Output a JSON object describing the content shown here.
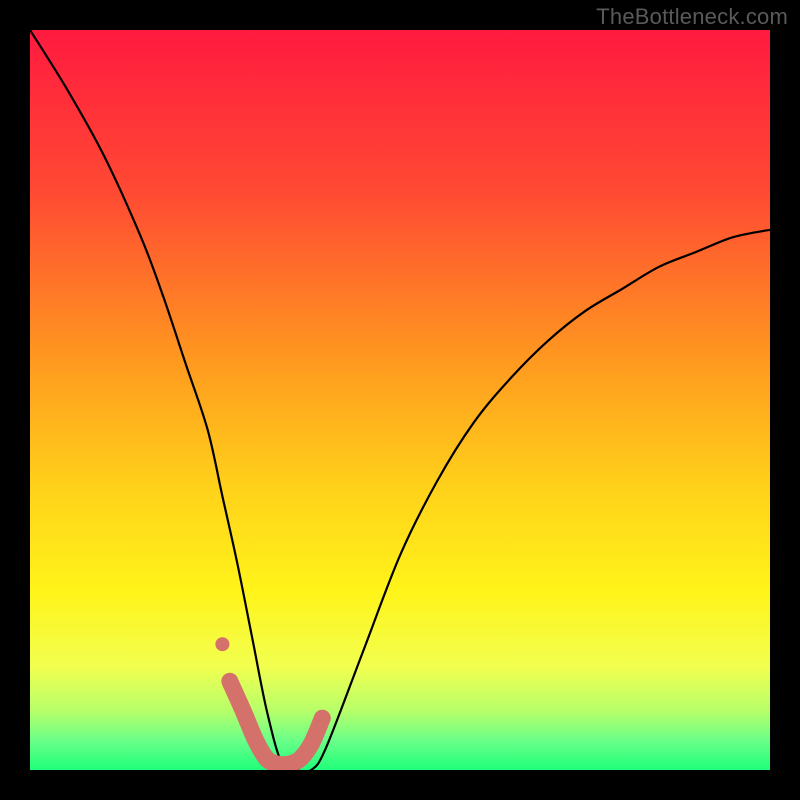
{
  "watermark": "TheBottleneck.com",
  "chart_data": {
    "type": "line",
    "title": "",
    "xlabel": "",
    "ylabel": "",
    "xlim": [
      0,
      100
    ],
    "ylim": [
      0,
      100
    ],
    "grid": false,
    "legend": false,
    "gradient_stops": [
      {
        "offset": 0.0,
        "color": "#ff1a3f"
      },
      {
        "offset": 0.22,
        "color": "#ff4a33"
      },
      {
        "offset": 0.45,
        "color": "#ff9a1f"
      },
      {
        "offset": 0.62,
        "color": "#ffd21a"
      },
      {
        "offset": 0.76,
        "color": "#fff41a"
      },
      {
        "offset": 0.86,
        "color": "#f2ff4f"
      },
      {
        "offset": 0.92,
        "color": "#b7ff6a"
      },
      {
        "offset": 0.96,
        "color": "#6aff88"
      },
      {
        "offset": 1.0,
        "color": "#1fff7a"
      }
    ],
    "series": [
      {
        "name": "bottleneck-curve",
        "x": [
          0,
          5,
          10,
          15,
          18,
          21,
          24,
          26,
          28,
          30,
          32,
          34,
          36,
          38,
          40,
          45,
          50,
          55,
          60,
          65,
          70,
          75,
          80,
          85,
          90,
          95,
          100
        ],
        "y": [
          100,
          92,
          83,
          72,
          64,
          55,
          46,
          37,
          28,
          18,
          8,
          1,
          0,
          0,
          3,
          16,
          29,
          39,
          47,
          53,
          58,
          62,
          65,
          68,
          70,
          72,
          73
        ]
      }
    ],
    "marker_overlay": {
      "color": "#d4716a",
      "points_x": [
        27.0,
        28.8,
        30.5,
        32.0,
        33.5,
        35.0,
        36.5,
        38.0,
        39.5
      ],
      "points_y": [
        12.0,
        8.0,
        4.0,
        1.5,
        0.8,
        0.8,
        1.5,
        3.5,
        7.0
      ],
      "dot": {
        "x": 26.0,
        "y": 17.0
      }
    }
  }
}
